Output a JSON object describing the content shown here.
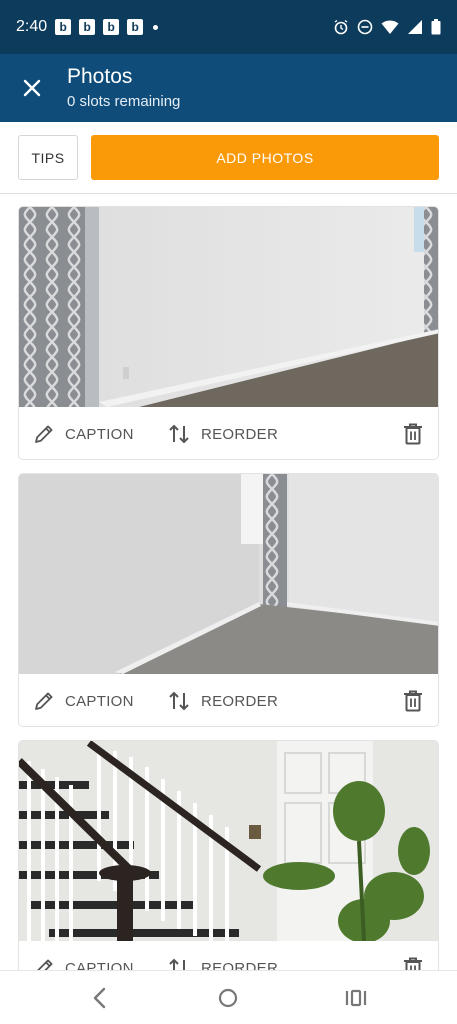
{
  "status_bar": {
    "time": "2:40",
    "notification_icons": [
      "b",
      "b",
      "b",
      "b"
    ]
  },
  "app_bar": {
    "title": "Photos",
    "subtitle": "0 slots remaining",
    "close_icon": "close-icon"
  },
  "actions": {
    "tips_label": "TIPS",
    "add_photos_label": "ADD PHOTOS",
    "accent_color": "#fb9a09",
    "header_color": "#0f4c7a"
  },
  "photo_cards": [
    {
      "caption_label": "CAPTION",
      "reorder_label": "REORDER",
      "photo": "bedroom-wall-with-patterned-curtain"
    },
    {
      "caption_label": "CAPTION",
      "reorder_label": "REORDER",
      "photo": "room-corner-with-window-and-carpet"
    },
    {
      "caption_label": "CAPTION",
      "reorder_label": "REORDER",
      "photo": "staircase-with-white-door-and-plant"
    }
  ],
  "nav_bar": {
    "icons": [
      "back-icon",
      "home-icon",
      "recents-icon"
    ]
  }
}
